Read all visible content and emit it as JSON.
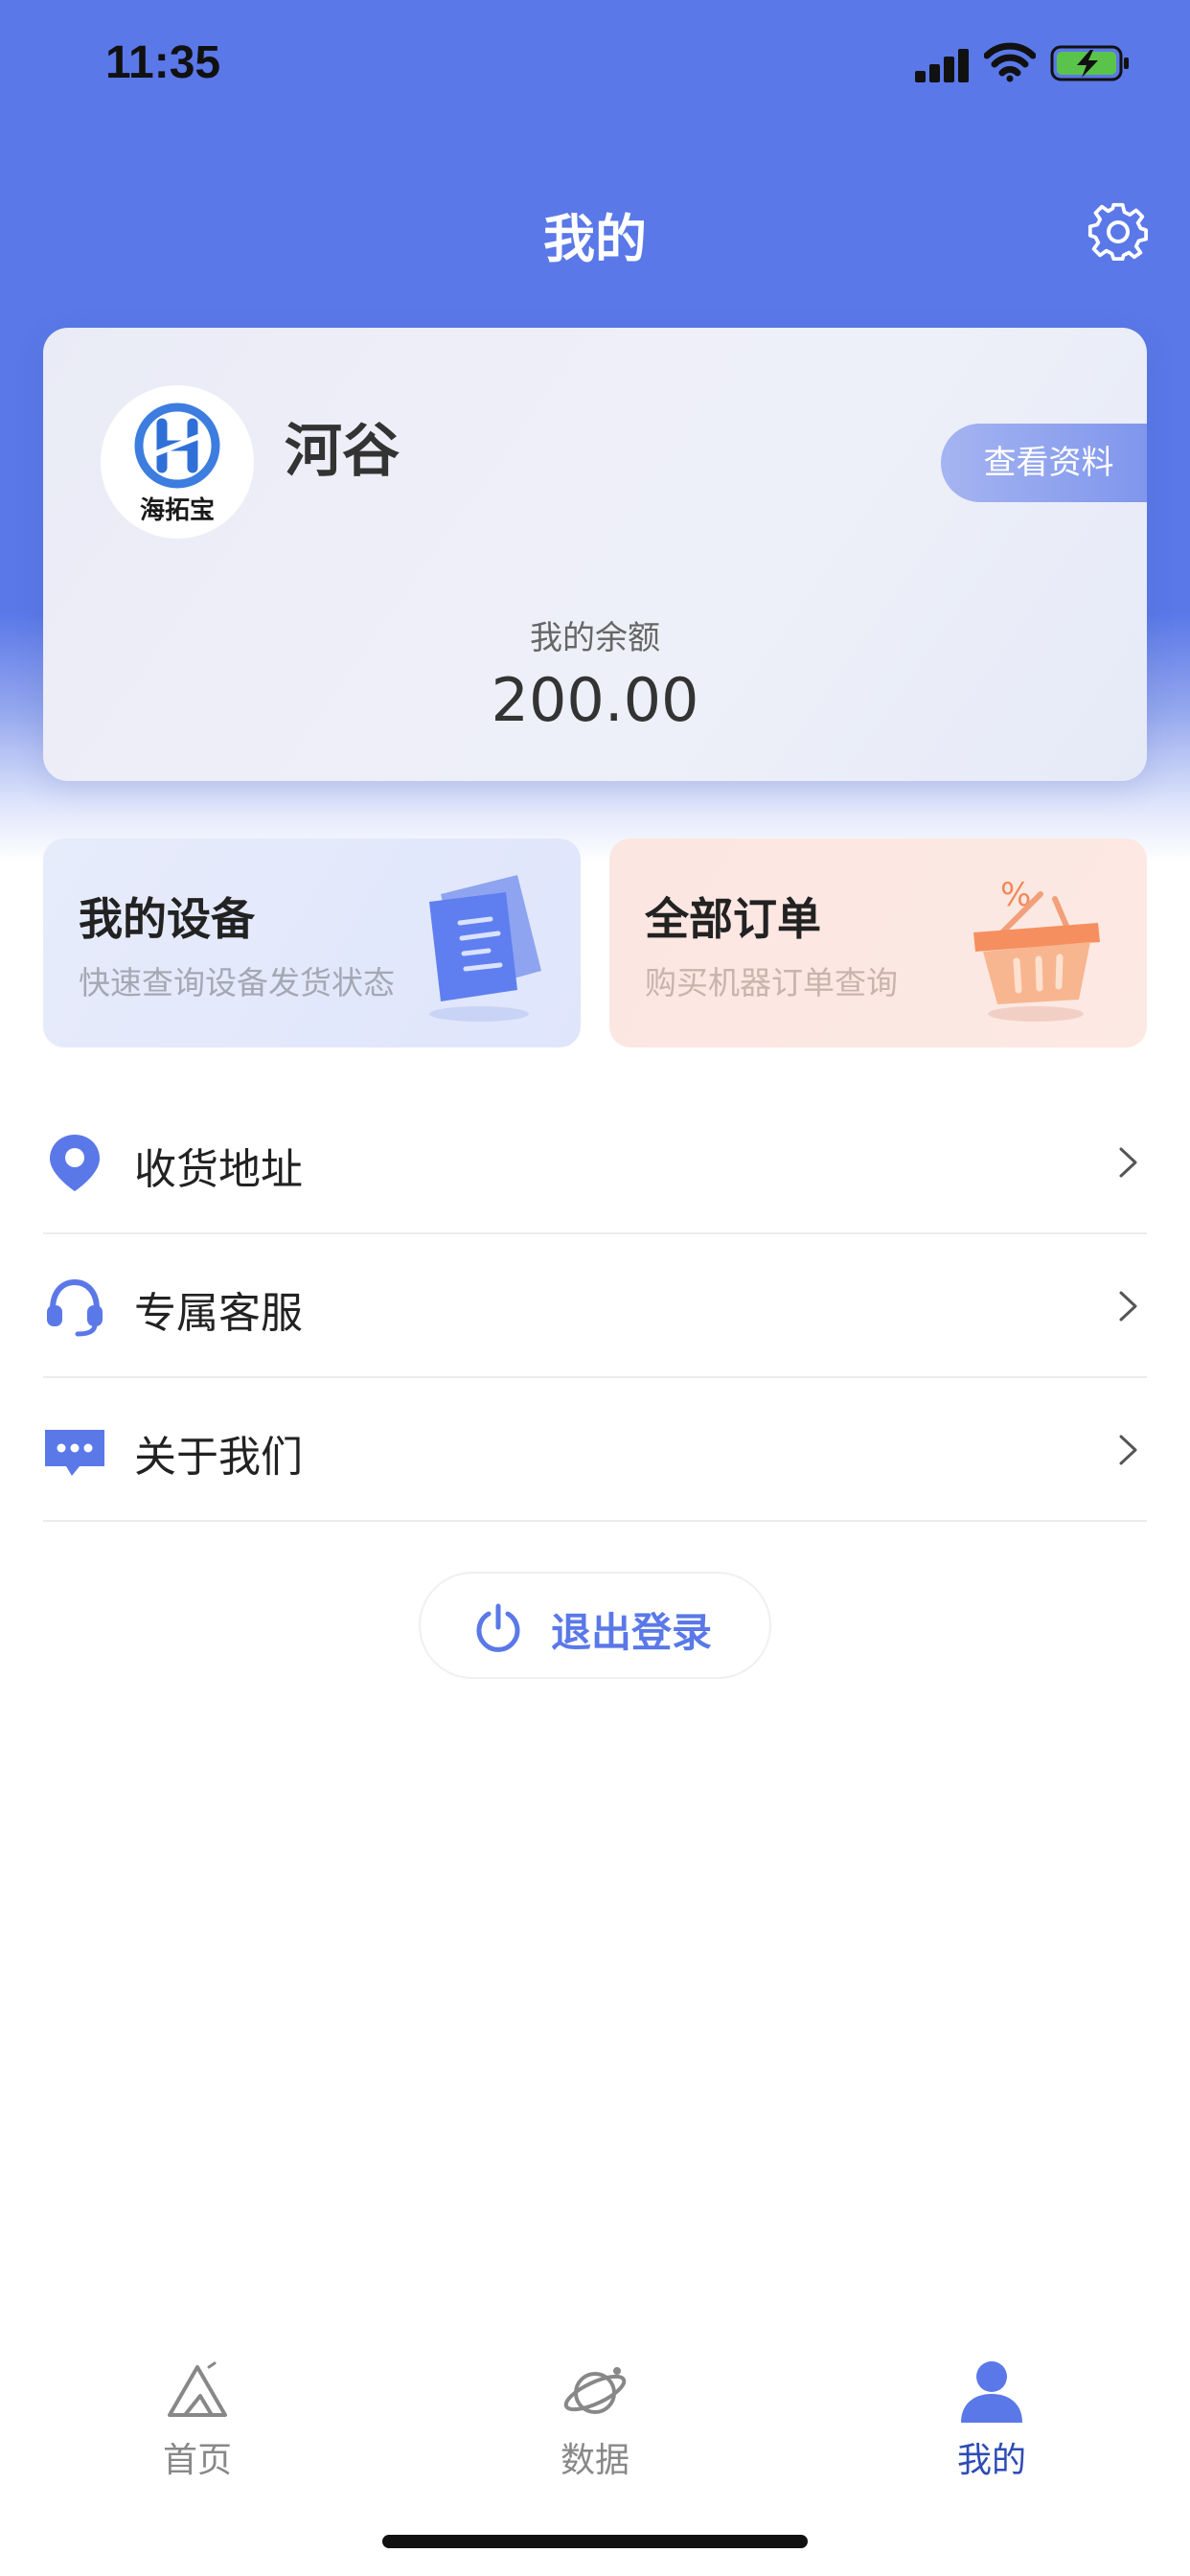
{
  "status_bar": {
    "time": "11:35"
  },
  "header": {
    "title": "我的"
  },
  "profile": {
    "avatar_text": "海拓宝",
    "name": "河谷",
    "view_profile_label": "查看资料",
    "balance_label": "我的余额",
    "balance_value": "200.00"
  },
  "quick_cards": [
    {
      "title": "我的设备",
      "subtitle": "快速查询设备发货状态",
      "icon": "document-icon"
    },
    {
      "title": "全部订单",
      "subtitle": "购买机器订单查询",
      "icon": "basket-icon"
    }
  ],
  "menu": [
    {
      "label": "收货地址",
      "icon": "location-pin-icon"
    },
    {
      "label": "专属客服",
      "icon": "headset-icon"
    },
    {
      "label": "关于我们",
      "icon": "chat-bubble-icon"
    }
  ],
  "logout": {
    "label": "退出登录",
    "icon": "power-icon"
  },
  "tabbar": [
    {
      "label": "首页",
      "icon": "mountain-icon",
      "active": false
    },
    {
      "label": "数据",
      "icon": "planet-icon",
      "active": false
    },
    {
      "label": "我的",
      "icon": "user-icon",
      "active": true
    }
  ],
  "colors": {
    "primary": "#5a78e8",
    "active_tab": "#2d4bb6",
    "battery_fill": "#5ac34a"
  }
}
